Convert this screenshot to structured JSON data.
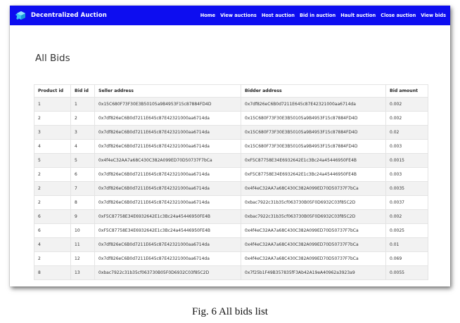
{
  "app": {
    "title": "Decentralized Auction"
  },
  "nav": {
    "links": [
      "Home",
      "View auctions",
      "Host auction",
      "Bid in auction",
      "Hault auction",
      "Close auction",
      "View bids"
    ]
  },
  "page": {
    "title": "All Bids"
  },
  "table": {
    "headers": [
      "Product id",
      "Bid id",
      "Seller address",
      "Bidder address",
      "Bid amount"
    ],
    "rows": [
      [
        "1",
        "1",
        "0x15C680F73F30E3B50105a9B4953F15c87884FD4D",
        "0x7df826eC6B0d7211E645c87E42321000aa6714da",
        "0.002"
      ],
      [
        "2",
        "2",
        "0x7df826eC6B0d7211E645c87E42321000aa6714da",
        "0x15C680F73F30E3B50105a9B4953F15c87884FD4D",
        "0.002"
      ],
      [
        "3",
        "3",
        "0x7df826eC6B0d7211E645c87E42321000aa6714da",
        "0x15C680F73F30E3B50105a9B4953F15c87884FD4D",
        "0.02"
      ],
      [
        "4",
        "4",
        "0x7df826eC6B0d7211E645c87E42321000aa6714da",
        "0x15C680F73F30E3B50105a9B4953F15c87884FD4D",
        "0.003"
      ],
      [
        "5",
        "5",
        "0x4f4eC32AA7a68C430C382A099ED70D50737F7bCa",
        "0xF5C87758E34E6932642E1c3Bc24a45446950FE4B",
        "0.0015"
      ],
      [
        "2",
        "6",
        "0x7df826eC6B0d7211E645c87E42321000aa6714da",
        "0xF5C87758E34E6932642E1c3Bc24a45446950FE4B",
        "0.003"
      ],
      [
        "2",
        "7",
        "0x7df826eC6B0d7211E645c87E42321000aa6714da",
        "0x4f4eC32AA7a68C430C382A099ED70D50737F7bCa",
        "0.0035"
      ],
      [
        "2",
        "8",
        "0x7df826eC6B0d7211E645c87E42321000aa6714da",
        "0xbac7922c31b35cf063730B05F0D6932C03f85C2D",
        "0.0037"
      ],
      [
        "6",
        "9",
        "0xF5C87758E34E6932642E1c3Bc24a45446950FE4B",
        "0xbac7922c31b35cf063730B05F0D6932C03f85C2D",
        "0.002"
      ],
      [
        "6",
        "10",
        "0xF5C87758E34E6932642E1c3Bc24a45446950FE4B",
        "0x4f4eC32AA7a68C430C382A099ED70D50737F7bCa",
        "0.0025"
      ],
      [
        "4",
        "11",
        "0x7df826eC6B0d7211E645c87E42321000aa6714da",
        "0x4f4eC32AA7a68C430C382A099ED70D50737F7bCa",
        "0.01"
      ],
      [
        "2",
        "12",
        "0x7df826eC6B0d7211E645c87E42321000aa6714da",
        "0x4f4eC32AA7a68C430C382A099ED70D50737F7bCa",
        "0.069"
      ],
      [
        "8",
        "13",
        "0xbac7922c31b35cf063730B05F0D6932C03f85C2D",
        "0x7f25b1F49B357835fF3Ab42A19eA40962a3923a9",
        "0.0055"
      ]
    ]
  },
  "caption": "Fig. 6 All bids list",
  "colors": {
    "navbar": "#0d0df0",
    "logo": "#39c3f4",
    "row_stripe": "#f2f2f2"
  },
  "icons": {
    "brand": "cube-network-logo-icon"
  }
}
